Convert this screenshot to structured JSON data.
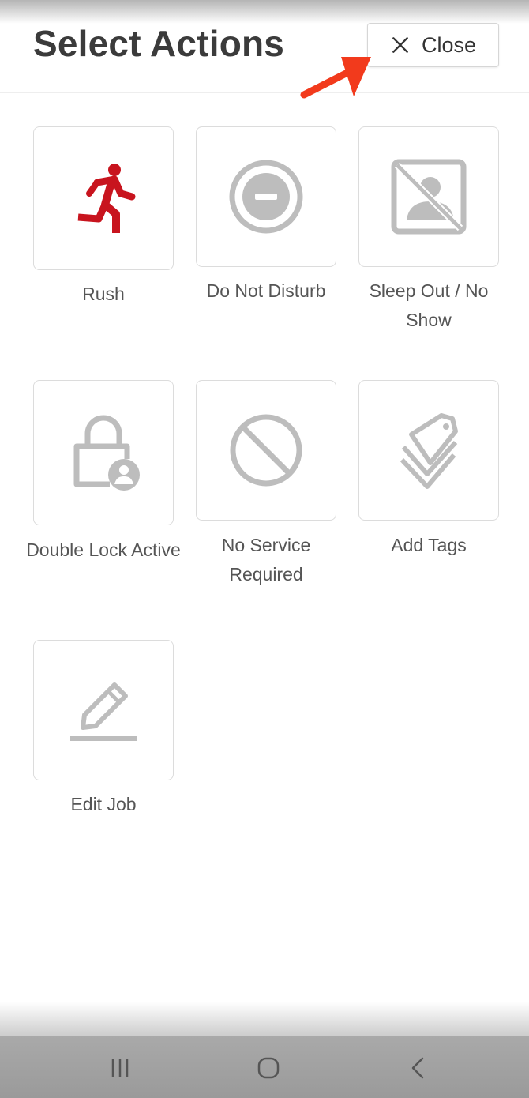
{
  "header": {
    "title": "Select Actions",
    "close_label": "Close"
  },
  "actions": [
    {
      "label": "Rush",
      "icon": "running-person-icon",
      "color": "#c8141e"
    },
    {
      "label": "Do Not Disturb",
      "icon": "do-not-disturb-icon",
      "color": "#bdbdbd"
    },
    {
      "label": "Sleep Out / No Show",
      "icon": "person-slashed-icon",
      "color": "#bdbdbd"
    },
    {
      "label": "Double Lock Active",
      "icon": "lock-person-icon",
      "color": "#bdbdbd"
    },
    {
      "label": "No Service Required",
      "icon": "block-icon",
      "color": "#bdbdbd"
    },
    {
      "label": "Add Tags",
      "icon": "tags-icon",
      "color": "#bdbdbd"
    },
    {
      "label": "Edit Job",
      "icon": "pencil-icon",
      "color": "#bdbdbd"
    }
  ],
  "colors": {
    "accent_red": "#c8141e",
    "annotation_arrow": "#f23a1c",
    "icon_gray": "#bdbdbd"
  }
}
